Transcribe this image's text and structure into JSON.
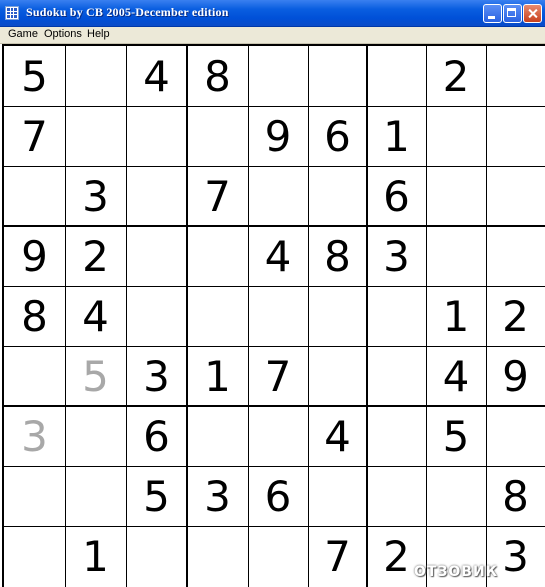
{
  "window": {
    "title": "Sudoku by CB 2005-December edition"
  },
  "menu": {
    "items": [
      "Game",
      "Options",
      "Help"
    ]
  },
  "grid": {
    "rows": [
      [
        "5",
        "",
        "4",
        "8",
        "",
        "",
        "",
        "2",
        ""
      ],
      [
        "7",
        "",
        "",
        "",
        "9",
        "6",
        "1",
        "",
        ""
      ],
      [
        "",
        "3",
        "",
        "7",
        "",
        "",
        "6",
        "",
        ""
      ],
      [
        "9",
        "2",
        "",
        "",
        "4",
        "8",
        "3",
        "",
        ""
      ],
      [
        "8",
        "4",
        "",
        "",
        "",
        "",
        "",
        "1",
        "2"
      ],
      [
        "",
        "5",
        "3",
        "1",
        "7",
        "",
        "",
        "4",
        "9"
      ],
      [
        "3",
        "",
        "6",
        "",
        "",
        "4",
        "",
        "5",
        ""
      ],
      [
        "",
        "",
        "5",
        "3",
        "6",
        "",
        "",
        "",
        "8"
      ],
      [
        "",
        "1",
        "",
        "",
        "",
        "7",
        "2",
        "",
        "3"
      ]
    ],
    "entered_cells": [
      [
        5,
        1
      ],
      [
        6,
        0
      ]
    ]
  },
  "colors": {
    "given_digit": "#000000",
    "entered_digit": "#a8a8a8",
    "titlebar": "#0a5ee0"
  },
  "watermark": "ОТЗОВИК"
}
